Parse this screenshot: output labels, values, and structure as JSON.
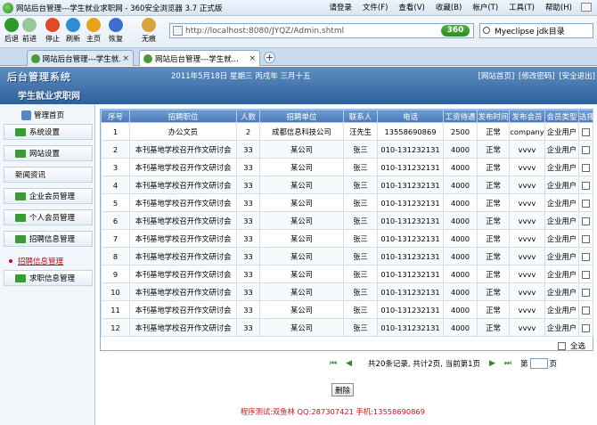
{
  "browser": {
    "window_title": "网站后台管理---学生就业求职网 - 360安全浏览器 3.7 正式版",
    "menus": [
      "请登录",
      "文件(F)",
      "查看(V)",
      "收藏(B)",
      "帐户(T)",
      "工具(T)",
      "帮助(H)"
    ],
    "nav_buttons": [
      {
        "label": "后退",
        "icon": "back-arrow-icon",
        "color": "#2c9b2c"
      },
      {
        "label": "前进",
        "icon": "forward-arrow-icon",
        "color": "#9ac79a"
      },
      {
        "label": "停止",
        "icon": "stop-icon",
        "color": "#e04a2a"
      },
      {
        "label": "刷新",
        "icon": "refresh-icon",
        "color": "#2c8fd6"
      },
      {
        "label": "主页",
        "icon": "home-icon",
        "color": "#e3a31c"
      },
      {
        "label": "恢复",
        "icon": "restore-icon",
        "color": "#3b6ed0"
      },
      {
        "label": "无痕",
        "icon": "incognito-icon",
        "color": "#d9a23a"
      }
    ],
    "address": "http://localhost:8080/JYQZ/Admin.shtml",
    "address_badge": "360",
    "search_text": "Myeclipse jdk目录",
    "tabs": [
      {
        "label": "网站后台管理---学生就...",
        "active": false
      },
      {
        "label": "网站后台管理---学生就...",
        "active": true
      }
    ],
    "new_tab_symbol": "+"
  },
  "site": {
    "brand": "后台管理系统",
    "subtitle": "学生就业求职网",
    "date_text": "2011年5月18日 星期三 丙戌年 三月十五",
    "top_links": [
      "[网站首页]",
      "[修改密码]",
      "[安全退出]"
    ]
  },
  "sidebar": {
    "header": "管理首页",
    "items": [
      {
        "label": "系统设置",
        "active": false
      },
      {
        "label": "网站设置",
        "active": false
      },
      {
        "label": "新闻资讯",
        "active": false
      },
      {
        "label": "企业会员管理",
        "active": false
      },
      {
        "label": "个人会员管理",
        "active": false
      },
      {
        "label": "招聘信息管理",
        "active": false
      },
      {
        "label": "招聘信息管理",
        "active": true
      },
      {
        "label": "求职信息管理",
        "active": false
      }
    ]
  },
  "table": {
    "columns": [
      "序号",
      "招聘职位",
      "人数",
      "招聘单位",
      "联系人",
      "电话",
      "工资待遇",
      "发布时间",
      "发布会员",
      "会员类型",
      "选择"
    ],
    "rows": [
      [
        "1",
        "办公文员",
        "2",
        "成都信息科技公司",
        "汪先生",
        "13558690869",
        "2500",
        "正常",
        "company",
        "企业用户"
      ],
      [
        "2",
        "本刊基地学校召开作文研讨会",
        "33",
        "某公司",
        "张三",
        "010-131232131",
        "4000",
        "正常",
        "vvvv",
        "企业用户"
      ],
      [
        "3",
        "本刊基地学校召开作文研讨会",
        "33",
        "某公司",
        "张三",
        "010-131232131",
        "4000",
        "正常",
        "vvvv",
        "企业用户"
      ],
      [
        "4",
        "本刊基地学校召开作文研讨会",
        "33",
        "某公司",
        "张三",
        "010-131232131",
        "4000",
        "正常",
        "vvvv",
        "企业用户"
      ],
      [
        "5",
        "本刊基地学校召开作文研讨会",
        "33",
        "某公司",
        "张三",
        "010-131232131",
        "4000",
        "正常",
        "vvvv",
        "企业用户"
      ],
      [
        "6",
        "本刊基地学校召开作文研讨会",
        "33",
        "某公司",
        "张三",
        "010-131232131",
        "4000",
        "正常",
        "vvvv",
        "企业用户"
      ],
      [
        "7",
        "本刊基地学校召开作文研讨会",
        "33",
        "某公司",
        "张三",
        "010-131232131",
        "4000",
        "正常",
        "vvvv",
        "企业用户"
      ],
      [
        "8",
        "本刊基地学校召开作文研讨会",
        "33",
        "某公司",
        "张三",
        "010-131232131",
        "4000",
        "正常",
        "vvvv",
        "企业用户"
      ],
      [
        "9",
        "本刊基地学校召开作文研讨会",
        "33",
        "某公司",
        "张三",
        "010-131232131",
        "4000",
        "正常",
        "vvvv",
        "企业用户"
      ],
      [
        "10",
        "本刊基地学校召开作文研讨会",
        "33",
        "某公司",
        "张三",
        "010-131232131",
        "4000",
        "正常",
        "vvvv",
        "企业用户"
      ],
      [
        "11",
        "本刊基地学校召开作文研讨会",
        "33",
        "某公司",
        "张三",
        "010-131232131",
        "4000",
        "正常",
        "vvvv",
        "企业用户"
      ],
      [
        "12",
        "本刊基地学校召开作文研讨会",
        "33",
        "某公司",
        "张三",
        "010-131232131",
        "4000",
        "正常",
        "vvvv",
        "企业用户"
      ]
    ],
    "select_all_label": "全选"
  },
  "pager": {
    "first": "⏮",
    "prev": "◀",
    "info": "共20条记录, 共计2页, 当前第1页",
    "next": "▶",
    "last": "⏭",
    "page_prefix": "第",
    "page_suffix": "页"
  },
  "actions": {
    "delete_label": "删除"
  },
  "footer": {
    "text": "程序测试:双鱼林 QQ:287307421 手机:13558690869"
  }
}
